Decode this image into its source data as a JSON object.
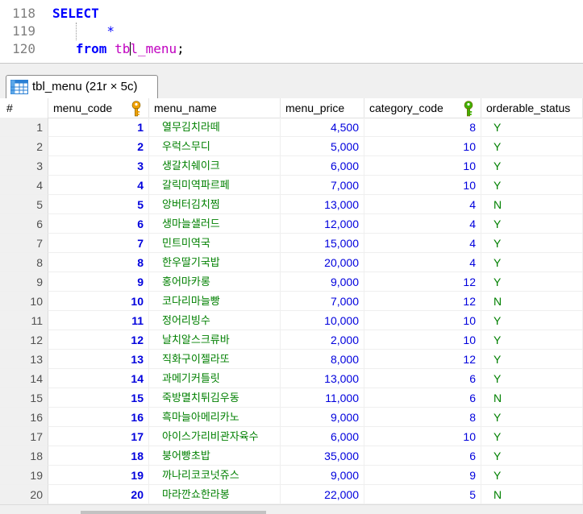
{
  "editor": {
    "lines": [
      {
        "no": "118",
        "tokens": [
          {
            "t": "SELECT",
            "c": "kw"
          }
        ]
      },
      {
        "no": "119",
        "tokens": [
          {
            "t": "       *",
            "c": "op"
          }
        ]
      },
      {
        "no": "120",
        "tokens": [
          {
            "t": "   from ",
            "c": "kw"
          },
          {
            "t": "tb",
            "c": "ident"
          },
          {
            "t": "|caret|",
            "c": "caret"
          },
          {
            "t": "l_menu",
            "c": "ident"
          },
          {
            "t": ";",
            "c": "punct"
          }
        ]
      }
    ]
  },
  "result_tab": {
    "label": "tbl_menu (21r × 5c)",
    "icon": "table-grid-icon"
  },
  "grid": {
    "columns": [
      {
        "label": "#",
        "key": false
      },
      {
        "label": "menu_code",
        "key": true,
        "key_color": "#f0a000"
      },
      {
        "label": "menu_name",
        "key": false
      },
      {
        "label": "menu_price",
        "key": false
      },
      {
        "label": "category_code",
        "key": true,
        "key_color": "#40b000"
      },
      {
        "label": "orderable_status",
        "key": false
      }
    ],
    "rows": [
      [
        "1",
        "1",
        "열무김치라떼",
        "4,500",
        "8",
        "Y"
      ],
      [
        "2",
        "2",
        "우럭스무디",
        "5,000",
        "10",
        "Y"
      ],
      [
        "3",
        "3",
        "생갈치쉐이크",
        "6,000",
        "10",
        "Y"
      ],
      [
        "4",
        "4",
        "갈릭미역파르페",
        "7,000",
        "10",
        "Y"
      ],
      [
        "5",
        "5",
        "앙버터김치찜",
        "13,000",
        "4",
        "N"
      ],
      [
        "6",
        "6",
        "생마늘샐러드",
        "12,000",
        "4",
        "Y"
      ],
      [
        "7",
        "7",
        "민트미역국",
        "15,000",
        "4",
        "Y"
      ],
      [
        "8",
        "8",
        "한우딸기국밥",
        "20,000",
        "4",
        "Y"
      ],
      [
        "9",
        "9",
        "홍어마카롱",
        "9,000",
        "12",
        "Y"
      ],
      [
        "10",
        "10",
        "코다리마늘빵",
        "7,000",
        "12",
        "N"
      ],
      [
        "11",
        "11",
        "정어리빙수",
        "10,000",
        "10",
        "Y"
      ],
      [
        "12",
        "12",
        "날치알스크류바",
        "2,000",
        "10",
        "Y"
      ],
      [
        "13",
        "13",
        "직화구이젤라또",
        "8,000",
        "12",
        "Y"
      ],
      [
        "14",
        "14",
        "과메기커틀릿",
        "13,000",
        "6",
        "Y"
      ],
      [
        "15",
        "15",
        "죽방멸치튀김우동",
        "11,000",
        "6",
        "N"
      ],
      [
        "16",
        "16",
        "흑마늘아메리카노",
        "9,000",
        "8",
        "Y"
      ],
      [
        "17",
        "17",
        "아이스가리비관자육수",
        "6,000",
        "10",
        "Y"
      ],
      [
        "18",
        "18",
        "붕어빵초밥",
        "35,000",
        "6",
        "Y"
      ],
      [
        "19",
        "19",
        "까나리코코넛쥬스",
        "9,000",
        "9",
        "Y"
      ],
      [
        "20",
        "20",
        "마라깐쇼한라봉",
        "22,000",
        "5",
        "N"
      ]
    ]
  },
  "colors": {
    "keyword": "#0000ff",
    "identifier": "#c000c0",
    "number": "#0000dd",
    "string": "#008000"
  }
}
